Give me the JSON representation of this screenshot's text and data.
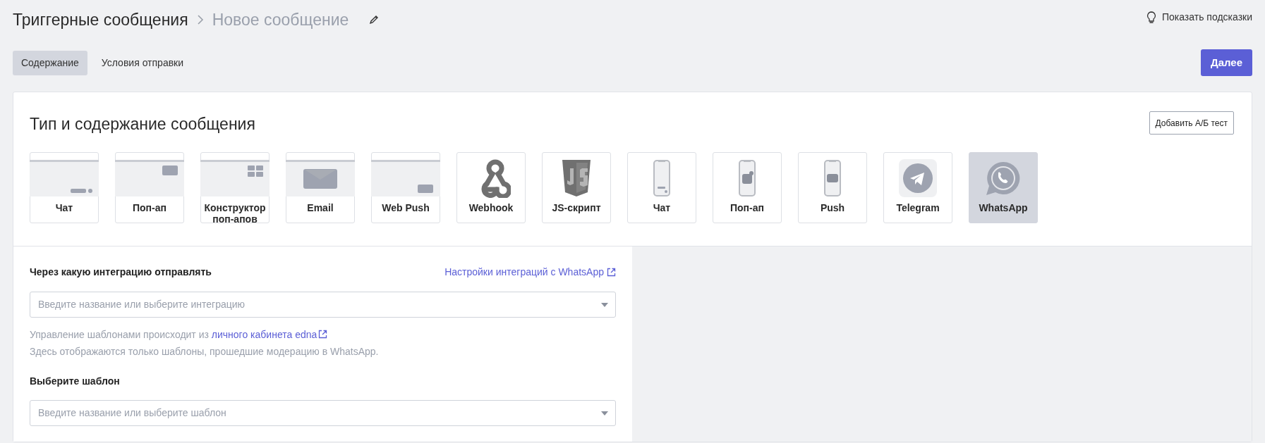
{
  "breadcrumb": {
    "parent": "Триггерные сообщения",
    "current": "Новое сообщение"
  },
  "hints_link": "Показать подсказки",
  "tabs": [
    {
      "label": "Содержание",
      "selected": true
    },
    {
      "label": "Условия отправки",
      "selected": false
    }
  ],
  "next_button": "Далее",
  "card": {
    "title": "Тип и содержание сообщения",
    "ab_button": "Добавить А/Б тест",
    "message_types": [
      {
        "kind": "web-chat",
        "label": "Чат",
        "selected": false
      },
      {
        "kind": "web-popup",
        "label": "Поп-ап",
        "selected": false
      },
      {
        "kind": "web-constructor",
        "label": "Конструктор поп-апов",
        "selected": false
      },
      {
        "kind": "email",
        "label": "Email",
        "selected": false
      },
      {
        "kind": "web-push",
        "label": "Web Push",
        "selected": false
      },
      {
        "kind": "webhook",
        "label": "Webhook",
        "selected": false
      },
      {
        "kind": "js",
        "label": "JS-скрипт",
        "selected": false
      },
      {
        "kind": "mobile-chat",
        "label": "Чат",
        "selected": false
      },
      {
        "kind": "mobile-popup",
        "label": "Поп-ап",
        "selected": false
      },
      {
        "kind": "mobile-push",
        "label": "Push",
        "selected": false
      },
      {
        "kind": "telegram",
        "label": "Telegram",
        "selected": false
      },
      {
        "kind": "whatsapp",
        "label": "WhatsApp",
        "selected": true
      }
    ],
    "form": {
      "integration_label": "Через какую интеграцию отправлять",
      "settings_link": "Настройки интеграций с WhatsApp",
      "integration_field": {
        "placeholder": "Введите название или выберите интеграцию"
      },
      "help_prefix": "Управление шаблонами происходит из ",
      "help_link": "личного кабинета edna",
      "help_note": "Здесь отображаются только шаблоны, прошедшие модерацию в WhatsApp.",
      "template_label": "Выберите шаблон",
      "template_field": {
        "placeholder": "Введите название или выберите шаблон"
      }
    }
  }
}
